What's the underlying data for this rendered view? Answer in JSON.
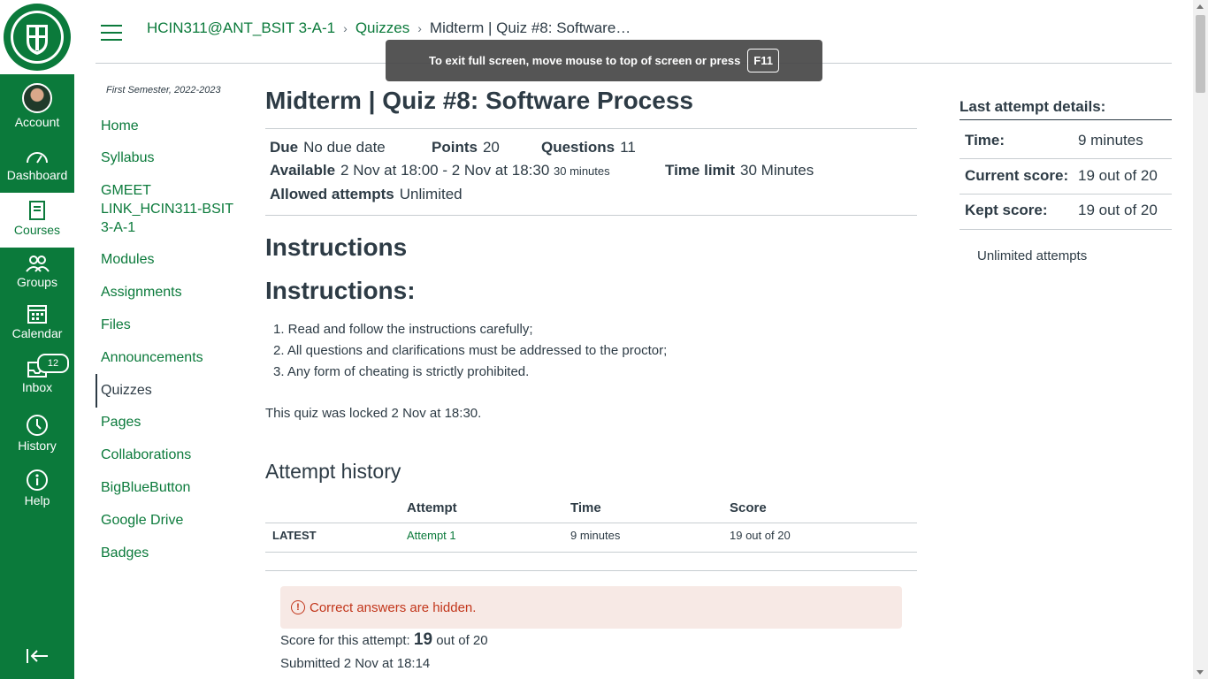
{
  "brand": {
    "accent": "#0b7a3b",
    "text": "#2d3b45",
    "alert_bg": "#f7e9e5",
    "alert_text": "#c2361b"
  },
  "global_nav": {
    "items": [
      {
        "label": "Account",
        "icon": "avatar-icon"
      },
      {
        "label": "Dashboard",
        "icon": "dashboard-icon"
      },
      {
        "label": "Courses",
        "icon": "courses-icon"
      },
      {
        "label": "Groups",
        "icon": "groups-icon"
      },
      {
        "label": "Calendar",
        "icon": "calendar-icon"
      },
      {
        "label": "Inbox",
        "icon": "inbox-icon",
        "badge": "12"
      },
      {
        "label": "History",
        "icon": "clock-icon"
      },
      {
        "label": "Help",
        "icon": "help-icon"
      }
    ],
    "collapse_icon": "collapse-arrow-icon"
  },
  "breadcrumbs": {
    "course": "HCIN311@ANT_BSIT 3-A-1",
    "section": "Quizzes",
    "current": "Midterm | Quiz #8: Software…"
  },
  "fullscreen_toast": {
    "text": "To exit full screen, move mouse to top of screen or press",
    "key": "F11"
  },
  "course_nav": {
    "term": "First Semester, 2022-2023",
    "items": [
      {
        "label": "Home"
      },
      {
        "label": "Syllabus"
      },
      {
        "label": "GMEET LINK_HCIN311-BSIT 3-A-1"
      },
      {
        "label": "Modules"
      },
      {
        "label": "Assignments"
      },
      {
        "label": "Files"
      },
      {
        "label": "Announcements"
      },
      {
        "label": "Quizzes"
      },
      {
        "label": "Pages"
      },
      {
        "label": "Collaborations"
      },
      {
        "label": "BigBlueButton"
      },
      {
        "label": "Google Drive"
      },
      {
        "label": "Badges"
      }
    ]
  },
  "quiz": {
    "title": "Midterm | Quiz #8: Software Process",
    "due_label": "Due",
    "due": "No due date",
    "points_label": "Points",
    "points": "20",
    "questions_label": "Questions",
    "questions": "11",
    "available_label": "Available",
    "available": "2 Nov at 18:00 - 2 Nov at 18:30",
    "available_duration": "30 minutes",
    "time_limit_label": "Time limit",
    "time_limit": "30 Minutes",
    "attempts_label": "Allowed attempts",
    "attempts": "Unlimited"
  },
  "instructions": {
    "heading": "Instructions",
    "subheading": "Instructions:",
    "items": [
      "1. Read and follow the instructions carefully;",
      "2. All questions and clarifications must be addressed to the proctor;",
      "3. Any form of cheating is strictly prohibited."
    ],
    "locked_note": "This quiz was locked 2 Nov at 18:30."
  },
  "attempt_history": {
    "heading": "Attempt history",
    "columns": [
      "Attempt",
      "Time",
      "Score"
    ],
    "rows": [
      {
        "tag": "LATEST",
        "attempt": "Attempt 1",
        "time": "9 minutes",
        "score": "19 out of 20"
      }
    ]
  },
  "result": {
    "alert": "Correct answers are hidden.",
    "score_prefix": "Score for this attempt:",
    "score_value": "19",
    "score_suffix": "out of 20",
    "submitted": "Submitted 2 Nov at 18:14"
  },
  "sidebar": {
    "title": "Last attempt details:",
    "rows": [
      {
        "label": "Time:",
        "value": "9 minutes"
      },
      {
        "label": "Current score:",
        "value": "19 out of 20"
      },
      {
        "label": "Kept score:",
        "value": "19 out of 20"
      }
    ],
    "note": "Unlimited attempts"
  }
}
